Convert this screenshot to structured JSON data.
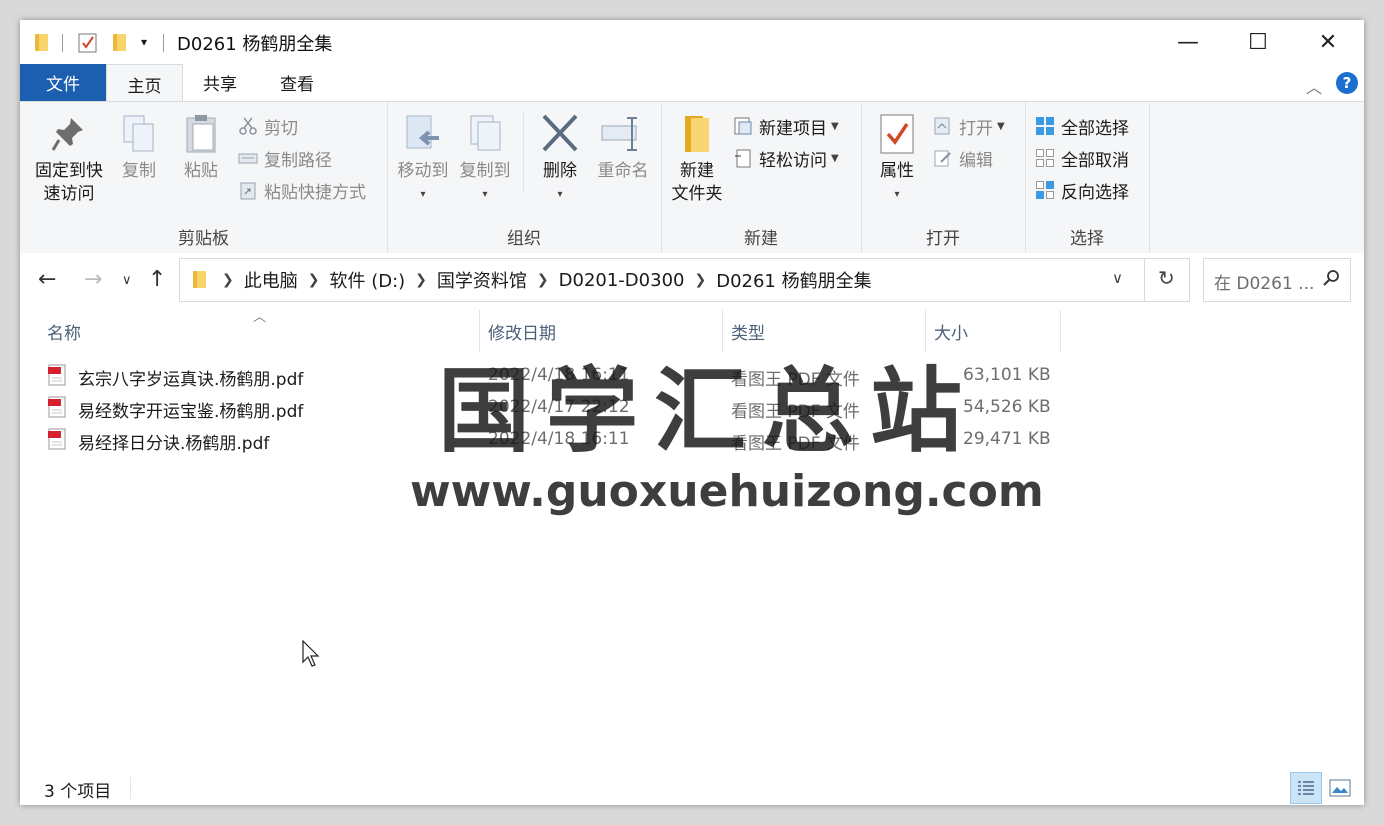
{
  "window": {
    "title": "D0261 杨鹤朋全集",
    "controls": {
      "minimize": "—",
      "maximize": "☐",
      "close": "✕"
    }
  },
  "ribbon_tabs": [
    {
      "label": "文件"
    },
    {
      "label": "主页"
    },
    {
      "label": "共享"
    },
    {
      "label": "查看"
    }
  ],
  "ribbon": {
    "clipboard": {
      "label": "剪贴板",
      "pin": "固定到快\n速访问",
      "pin_line1": "固定到快",
      "pin_line2": "速访问",
      "copy": "复制",
      "paste": "粘贴",
      "cut": "剪切",
      "copy_path": "复制路径",
      "paste_shortcut": "粘贴快捷方式"
    },
    "organize": {
      "label": "组织",
      "move_to": "移动到",
      "copy_to": "复制到",
      "delete": "删除",
      "rename": "重命名"
    },
    "new": {
      "label": "新建",
      "new_folder_line1": "新建",
      "new_folder_line2": "文件夹",
      "new_item": "新建项目",
      "easy_access": "轻松访问"
    },
    "open": {
      "label": "打开",
      "properties": "属性",
      "open": "打开",
      "edit": "编辑"
    },
    "select": {
      "label": "选择",
      "select_all": "全部选择",
      "select_none": "全部取消",
      "invert": "反向选择"
    }
  },
  "address": {
    "crumbs": [
      "此电脑",
      "软件 (D:)",
      "国学资料馆",
      "D0201-D0300",
      "D0261 杨鹤朋全集"
    ],
    "search_placeholder": "在 D0261 ..."
  },
  "columns": {
    "name": "名称",
    "date": "修改日期",
    "type": "类型",
    "size": "大小"
  },
  "files": [
    {
      "name": "玄宗八字岁运真诀.杨鹤朋.pdf",
      "date": "2022/4/18 16:11",
      "type": "看图王 PDF 文件",
      "size": "63,101 KB"
    },
    {
      "name": "易经数字开运宝鉴.杨鹤朋.pdf",
      "date": "2022/4/17 22:12",
      "type": "看图王 PDF 文件",
      "size": "54,526 KB"
    },
    {
      "name": "易经择日分诀.杨鹤朋.pdf",
      "date": "2022/4/18 16:11",
      "type": "看图王 PDF 文件",
      "size": "29,471 KB"
    }
  ],
  "watermark": {
    "title": "国学汇总站",
    "url": "www.guoxuehuizong.com"
  },
  "status": {
    "count": "3 个项目"
  },
  "colors": {
    "file_tab": "#1c5fb0",
    "accent": "#1c6fd0",
    "folder": "#f7d56a"
  }
}
